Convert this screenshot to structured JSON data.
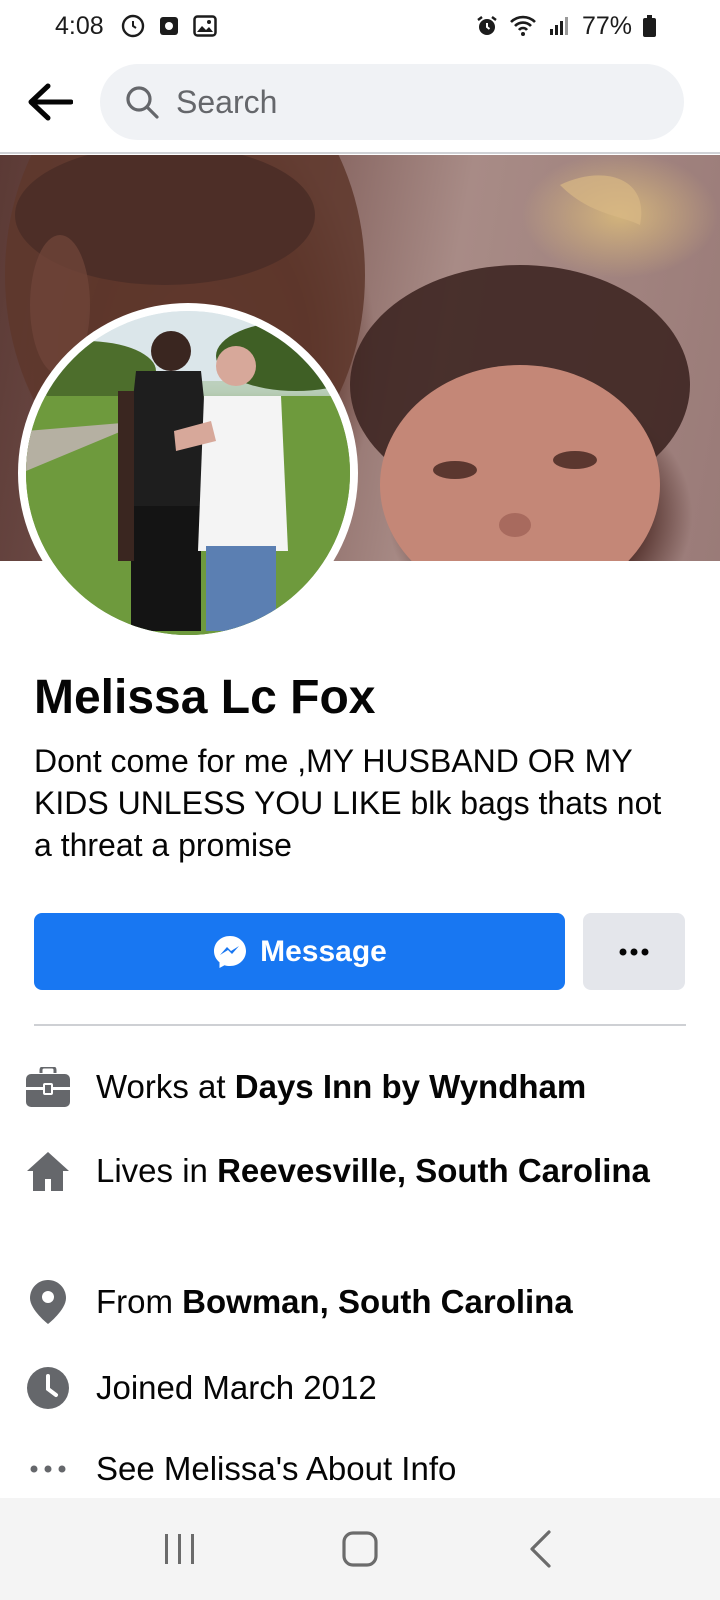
{
  "status_bar": {
    "time": "4:08",
    "battery": "77%",
    "left_icons": [
      "circle-status-icon",
      "record-icon",
      "gallery-icon"
    ],
    "right_icons": [
      "alarm-icon",
      "wifi-icon",
      "signal-icon",
      "battery-icon"
    ]
  },
  "top_bar": {
    "search_placeholder": "Search"
  },
  "profile": {
    "name": "Melissa Lc Fox",
    "bio": "Dont come for me ,MY HUSBAND OR MY KIDS UNLESS YOU LIKE blk bags thats not a threat a promise"
  },
  "actions": {
    "message_label": "Message",
    "more_label": "•••"
  },
  "intro": {
    "work_prefix": "Works at ",
    "work_value": "Days Inn by Wyndham",
    "lives_prefix": "Lives in ",
    "lives_value": "Reevesville, South Carolina",
    "from_prefix": "From ",
    "from_value": "Bowman, South Carolina",
    "joined": "Joined March 2012",
    "about_link": "See Melissa's About Info"
  },
  "colors": {
    "accent": "#1877f2",
    "icon_gray": "#65676b",
    "secondary_button": "#e4e6eb"
  }
}
